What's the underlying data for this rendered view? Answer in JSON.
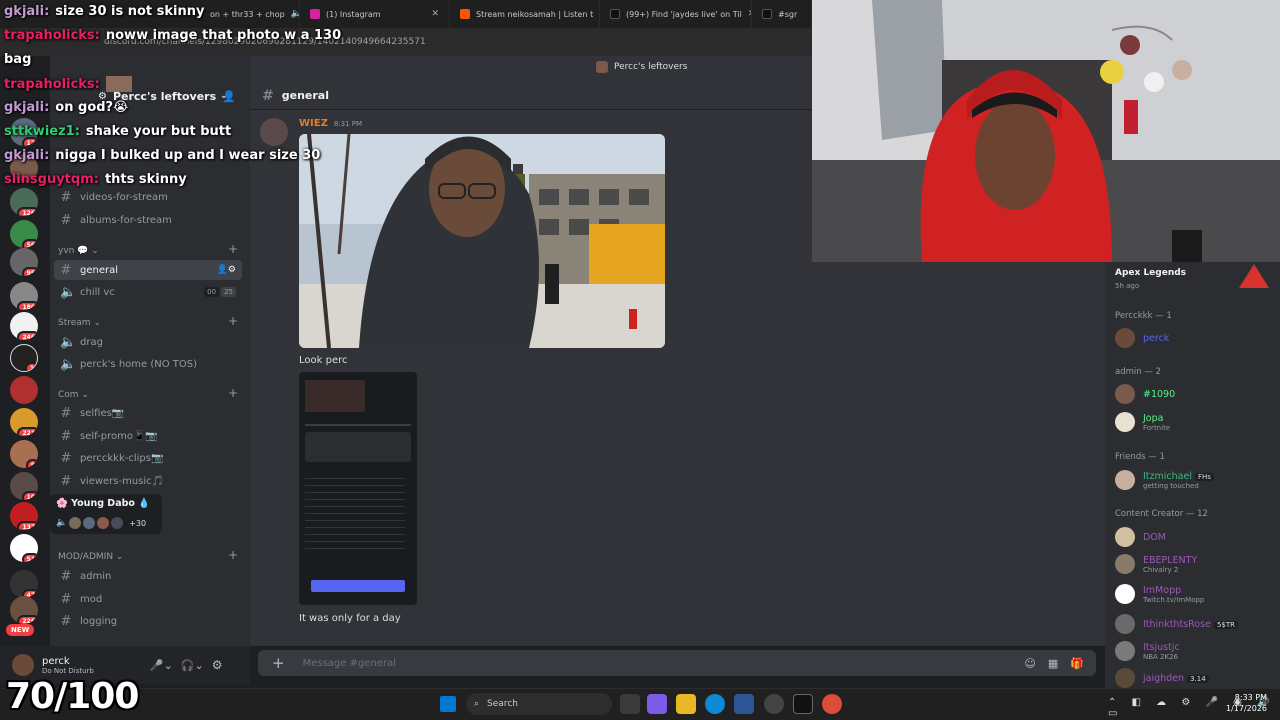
{
  "browser": {
    "tabs": [
      {
        "label": "on + thr33 + chop",
        "color": "#5865f2"
      },
      {
        "label": "(1) Instagram",
        "color": "#d6249f"
      },
      {
        "label": "Stream neikosamah | Listen t",
        "color": "#ff5500"
      },
      {
        "label": "(99+) Find 'jaydes live' on Til",
        "color": "#111111"
      },
      {
        "label": "#sgr",
        "color": "#111111"
      }
    ],
    "url": "discord.com/channels/1298029020696281129/1402140949664235571"
  },
  "server": {
    "name": "Percc's leftovers",
    "rail_badges": [
      "12",
      "126",
      "56",
      "95",
      "180",
      "246",
      "1",
      "221",
      "9",
      "10",
      "137",
      "51",
      "47",
      "226",
      "NEW"
    ]
  },
  "sidebar": {
    "top_channels": [
      {
        "name": "videos-for-stream"
      },
      {
        "name": "albums-for-stream"
      }
    ],
    "cat_yvn": "yvn",
    "yvn_channels": [
      {
        "name": "general",
        "type": "text",
        "selected": true
      },
      {
        "name": "chill vc",
        "type": "voice",
        "counts": [
          "00",
          "25"
        ]
      }
    ],
    "cat_stream": "Stream",
    "stream_channels": [
      {
        "name": "drag",
        "type": "voice"
      },
      {
        "name": "perck's home (NO TOS)",
        "type": "voice"
      }
    ],
    "cat_com": "Com",
    "com_channels": [
      {
        "name": "selfies📷",
        "type": "text"
      },
      {
        "name": "self-promo📱📷",
        "type": "text"
      },
      {
        "name": "percckkk-clips📷",
        "type": "text"
      },
      {
        "name": "viewers-music🎵",
        "type": "text"
      }
    ],
    "voice_user": "Young Dabo",
    "voice_more": "+30",
    "cat_mod": "MOD/ADMIN",
    "mod_channels": [
      {
        "name": "admin"
      },
      {
        "name": "mod"
      },
      {
        "name": "logging"
      }
    ]
  },
  "user_panel": {
    "name": "perck",
    "status": "Do Not Disturb"
  },
  "channel": {
    "name": "general",
    "top_banner": "Percc's leftovers"
  },
  "messages": [
    {
      "author": "WIEZ",
      "time": "8:31 PM",
      "text1": "Look perc",
      "text2": "It was only for a day"
    }
  ],
  "composer": {
    "placeholder": "Message #general"
  },
  "members": {
    "activity_game": "Apex Legends",
    "activity_time": "5h ago",
    "groups": [
      {
        "label": "Percckkk — 1",
        "members": [
          {
            "name": "perck",
            "color": "#5865f2",
            "sub": ""
          }
        ]
      },
      {
        "label": "admin — 2",
        "members": [
          {
            "name": "#1090",
            "color": "#57f287",
            "sub": ""
          },
          {
            "name": "Jopa",
            "color": "#57f287",
            "sub": "Fortnite"
          }
        ]
      },
      {
        "label": "Friends — 1",
        "members": [
          {
            "name": "Itzmichael",
            "color": "#43b581",
            "sub": "getting touched",
            "tag": "FHs"
          }
        ]
      },
      {
        "label": "Content Creator — 12",
        "members": [
          {
            "name": "DOM",
            "color": "#9b59b6",
            "sub": ""
          },
          {
            "name": "EBEPLENTY",
            "color": "#9b59b6",
            "sub": "Chivalry 2"
          },
          {
            "name": "ImMopp",
            "color": "#9b59b6",
            "sub": "Twitch.tv/ImMopp"
          },
          {
            "name": "IthinkthtsRose",
            "color": "#9b59b6",
            "sub": "",
            "tag": "5$TR"
          },
          {
            "name": "Itsjustjc",
            "color": "#9b59b6",
            "sub": "NBA 2K26"
          },
          {
            "name": "jaighden",
            "color": "#9b59b6",
            "sub": "",
            "tag": "3.14"
          }
        ]
      }
    ]
  },
  "stream_chat": [
    {
      "user": "gkjali:",
      "user_color": "#c39bd3",
      "text": "size 30 is not skinny"
    },
    {
      "user": "trapaholicks:",
      "user_color": "#e91e63",
      "text": "noww image that photo w a 130"
    },
    {
      "user": "",
      "user_color": "#ffffff",
      "text": "bag"
    },
    {
      "user": "trapaholicks:",
      "user_color": "#e91e63",
      "text": ""
    },
    {
      "user": "gkjali:",
      "user_color": "#c39bd3",
      "text": "on god?😭"
    },
    {
      "user": "sttkwiez1:",
      "user_color": "#2ecc71",
      "text": "shake your but butt"
    },
    {
      "user": "gkjali:",
      "user_color": "#c39bd3",
      "text": "nigga I bulked up and I wear size 30"
    },
    {
      "user": "slinsguytqm:",
      "user_color": "#e91e63",
      "text": "thts skinny"
    }
  ],
  "score": "70/100",
  "taskbar": {
    "search_label": "Search",
    "time": "8:33 PM",
    "date": "1/17/2026"
  },
  "colors": {
    "accent": "#5865f2",
    "dnd": "#f23f43",
    "author": "#e67e22"
  }
}
